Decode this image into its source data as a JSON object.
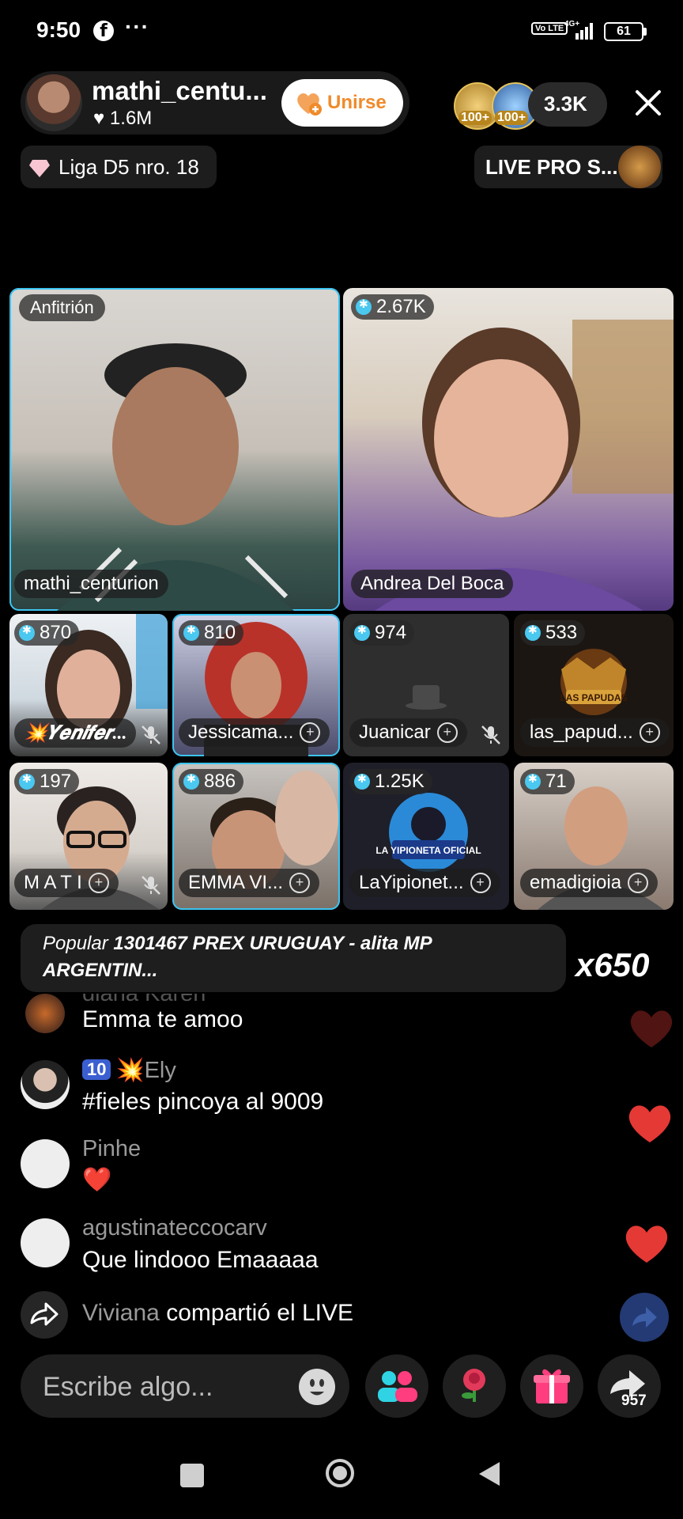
{
  "status_bar": {
    "time": "9:50",
    "dots": "···",
    "network": "4G+",
    "volte": "Vo LTE",
    "battery": "61"
  },
  "header": {
    "host_name": "mathi_centu...",
    "host_likes": "1.6M",
    "join_label": "Unirse",
    "viewer_badge_1": "100+",
    "viewer_badge_2": "100+",
    "viewer_count": "3.3K",
    "league_label": "Liga D5 nro. 18",
    "live_pro_label": "LIVE PRO S..."
  },
  "grid": {
    "host_tag": "Anfitrión",
    "tiles": [
      {
        "name": "mathi_centurion",
        "score": ""
      },
      {
        "name": "Andrea Del Boca",
        "score": "2.67K"
      },
      {
        "name": "💥𝒀𝒆𝒏𝒊𝒇𝒆𝒓...",
        "score": "870"
      },
      {
        "name": "Jessicama...",
        "score": "810"
      },
      {
        "name": "Juanicar",
        "score": "974"
      },
      {
        "name": "las_papud...",
        "score": "533"
      },
      {
        "name": "M A T I",
        "score": "197"
      },
      {
        "name": "EMMA VI...",
        "score": "886"
      },
      {
        "name": "LaYipionet...",
        "score": "1.25K"
      },
      {
        "name": "emadigioia",
        "score": "71"
      }
    ],
    "papudas_logo": "LAS PAPUDAS",
    "yipioneta_logo": "LA YIPIONETA OFICIAL"
  },
  "gift_banner": {
    "prefix": "Popular",
    "text": "1301467 PREX URUGUAY - alita MP ARGENTIN...",
    "multiplier": "x650"
  },
  "chat": [
    {
      "user": "diana Karen",
      "message": "Emma te amoo"
    },
    {
      "user": "💥Ely",
      "level": "10",
      "message": "#fieles pincoya al 9009"
    },
    {
      "user": "Pinhe",
      "message": "❤️"
    },
    {
      "user": "agustinateccocarv",
      "message": "Que lindooo Emaaaaa"
    }
  ],
  "share_event": {
    "user": "Viviana",
    "text": "compartió el LIVE"
  },
  "input": {
    "placeholder": "Escribe algo..."
  },
  "share_count": "957",
  "colors": {
    "accent": "#3bc4f0",
    "heart": "#e53935",
    "join": "#f08a2a"
  }
}
